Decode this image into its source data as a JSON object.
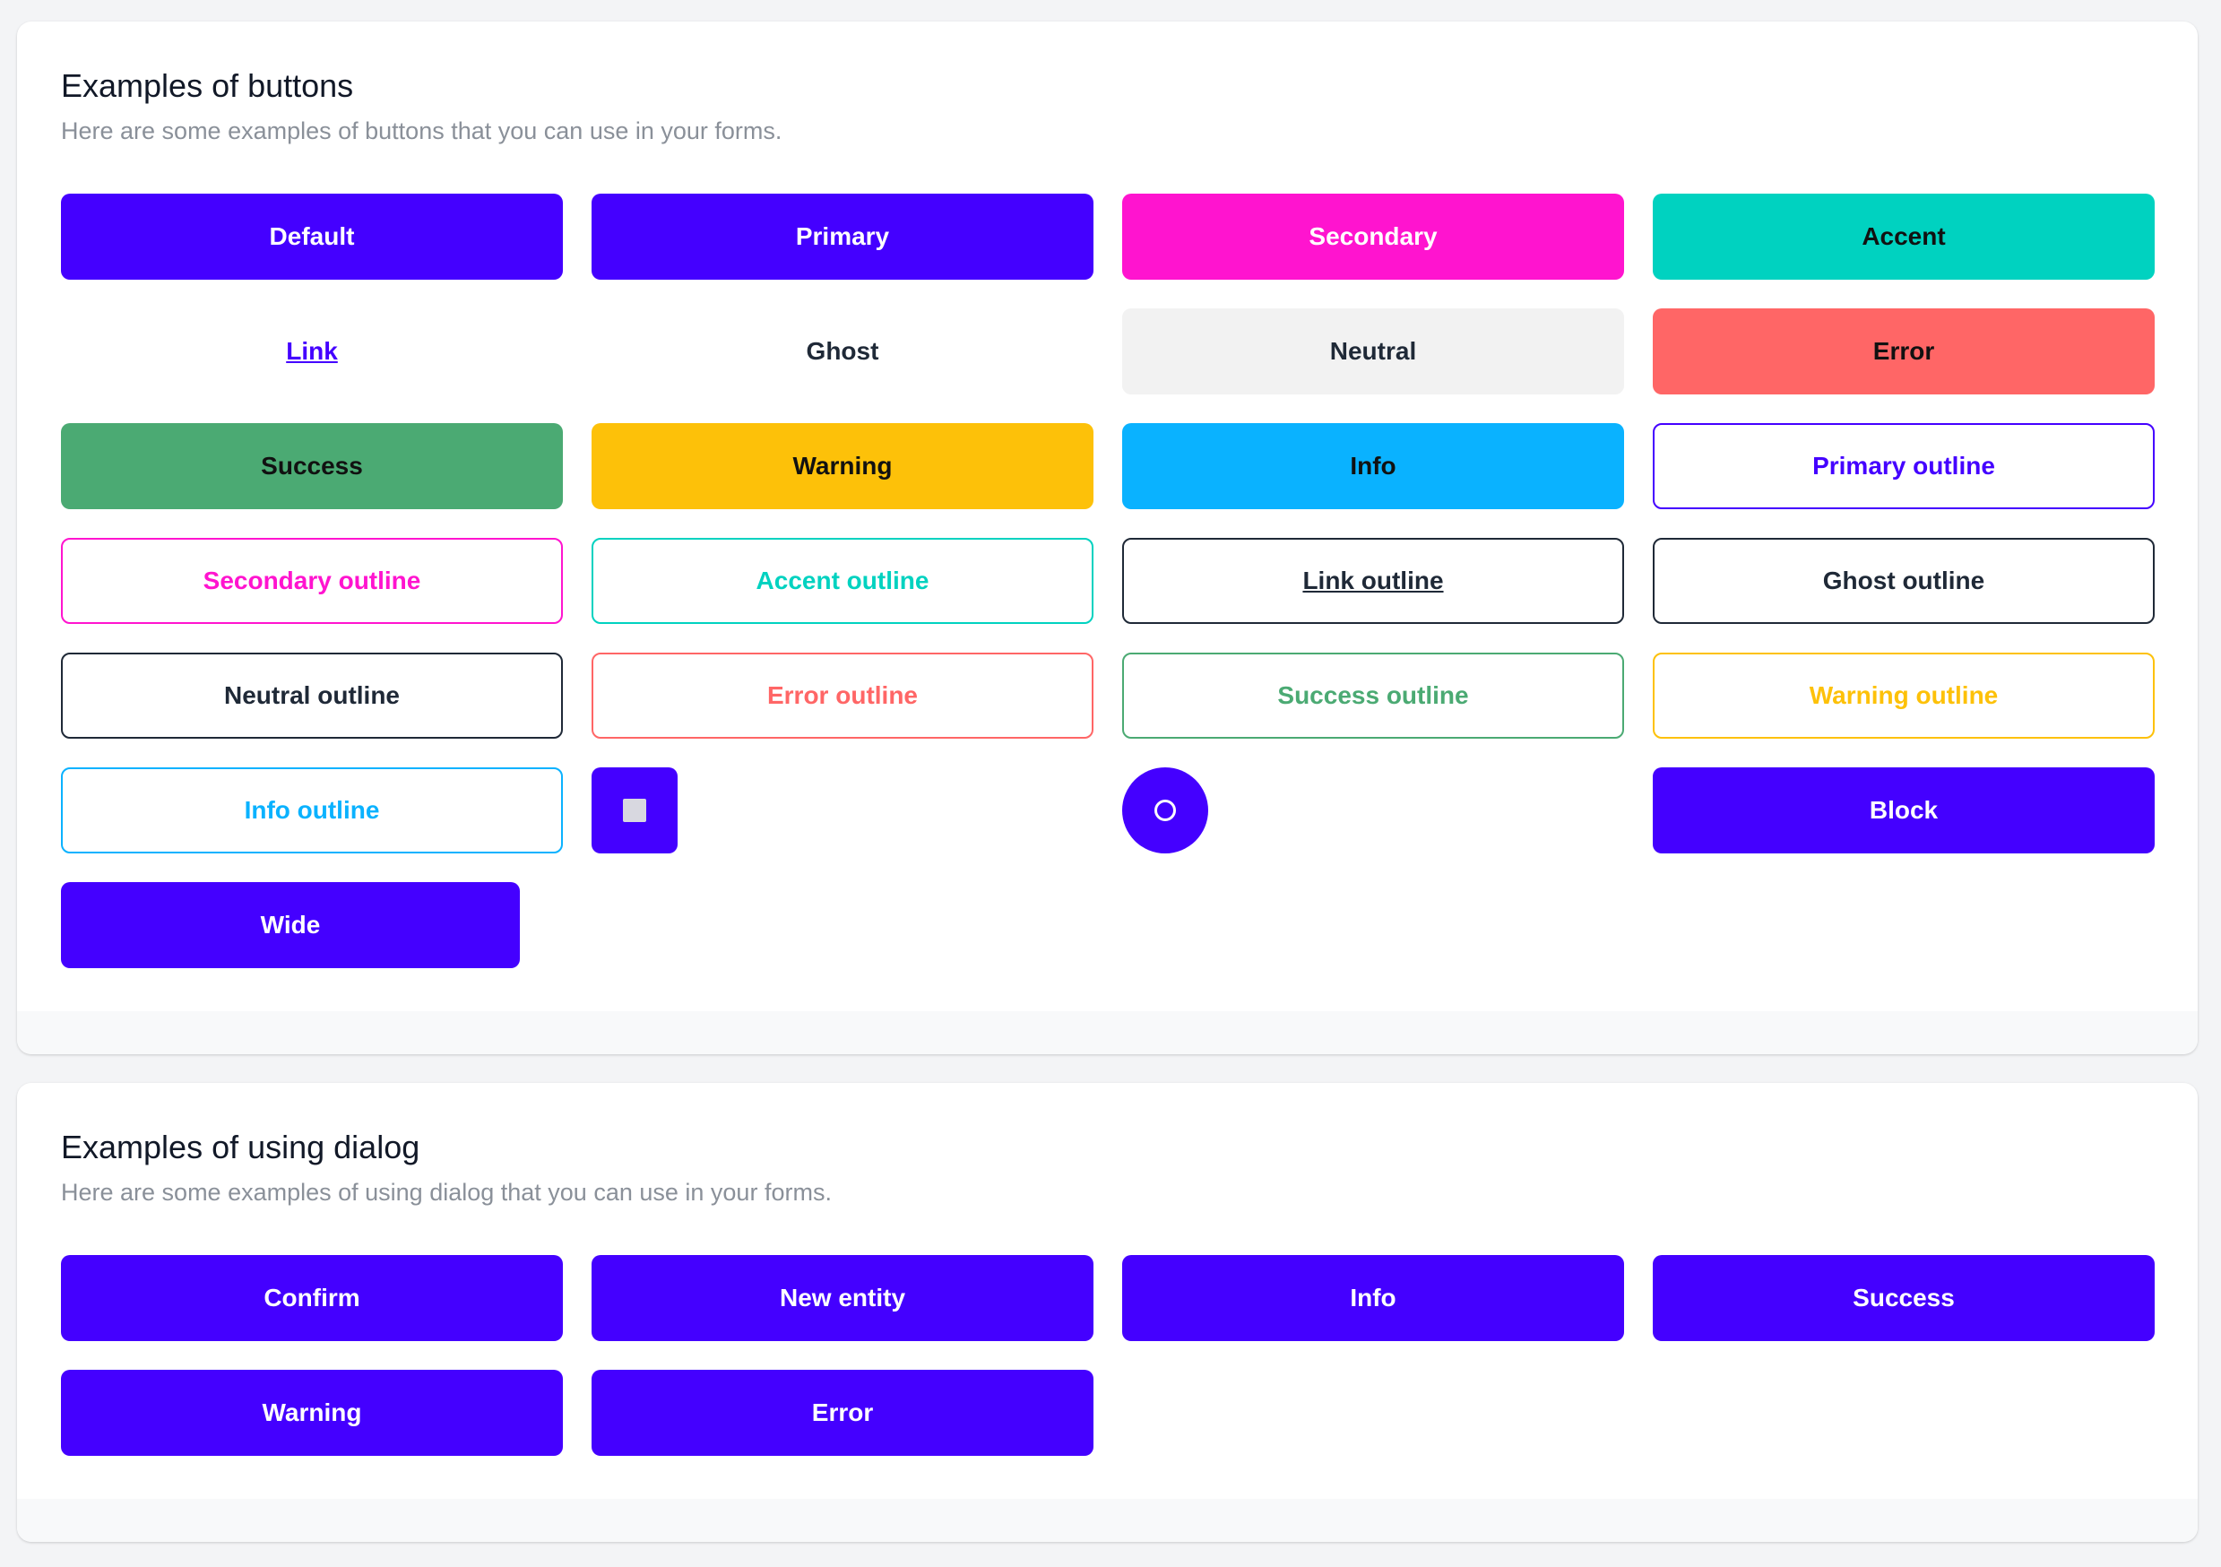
{
  "buttons_section": {
    "title": "Examples of buttons",
    "subtitle": "Here are some examples of buttons that you can use in your forms.",
    "default_label": "Default",
    "primary_label": "Primary",
    "secondary_label": "Secondary",
    "accent_label": "Accent",
    "link_label": "Link",
    "ghost_label": "Ghost",
    "neutral_label": "Neutral",
    "error_label": "Error",
    "success_label": "Success",
    "warning_label": "Warning",
    "info_label": "Info",
    "primary_outline_label": "Primary outline",
    "secondary_outline_label": "Secondary outline",
    "accent_outline_label": "Accent outline",
    "link_outline_label": "Link outline",
    "ghost_outline_label": "Ghost outline",
    "neutral_outline_label": "Neutral outline",
    "error_outline_label": "Error outline",
    "success_outline_label": "Success outline",
    "warning_outline_label": "Warning outline",
    "info_outline_label": "Info outline",
    "square_icon": "square-icon",
    "circle_icon": "circle-icon",
    "block_label": "Block",
    "wide_label": "Wide"
  },
  "dialog_section": {
    "title": "Examples of using dialog",
    "subtitle": "Here are some examples of using dialog that you can use in your forms.",
    "confirm_label": "Confirm",
    "new_entity_label": "New entity",
    "info_label": "Info",
    "success_label": "Success",
    "warning_label": "Warning",
    "error_label": "Error"
  },
  "colors": {
    "primary": "#4400ff",
    "secondary": "#ff14cf",
    "accent": "#00d2c0",
    "neutral": "#f2f2f2",
    "error": "#ff6666",
    "success": "#4baa73",
    "warning": "#fdc109",
    "info": "#0ab2ff"
  }
}
